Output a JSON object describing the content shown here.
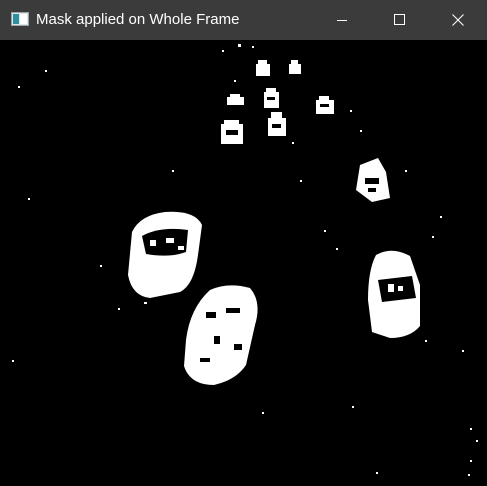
{
  "window": {
    "title": "Mask applied on Whole Frame",
    "titlebar_color": "#3b3b3b",
    "title_text_color": "#ffffff",
    "content_background": "#000000",
    "mask_foreground": "#ffffff"
  },
  "controls": {
    "minimize_icon": "minimize-icon",
    "maximize_icon": "maximize-icon",
    "close_icon": "close-icon"
  }
}
